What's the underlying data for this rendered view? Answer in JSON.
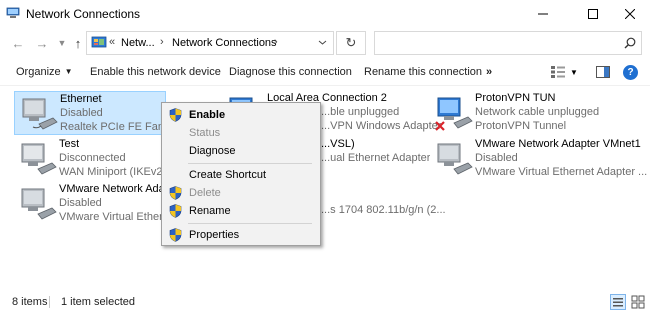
{
  "window": {
    "title": "Network Connections"
  },
  "address": {
    "crumbs": [
      "Netw...",
      "Network Connections"
    ],
    "overflow": "«",
    "search_placeholder": ""
  },
  "toolbar": {
    "organize": "Organize",
    "enable_device": "Enable this network device",
    "diagnose": "Diagnose this connection",
    "rename": "Rename this connection",
    "more": "»"
  },
  "connections": [
    {
      "name": "Ethernet",
      "status": "Disabled",
      "device": "Realtek PCIe FE Family C",
      "selected": true,
      "icon": "ethernet-adapter-icon"
    },
    {
      "name": "Local Area Connection 2",
      "status": "...ble unplugged",
      "device": "...VPN Windows Adapter",
      "selected": false,
      "icon": "ethernet-adapter-icon"
    },
    {
      "name": "ProtonVPN TUN",
      "status": "Network cable unplugged",
      "device": "ProtonVPN Tunnel",
      "selected": false,
      "icon": "disconnected-adapter-icon"
    },
    {
      "name": "Test",
      "status": "Disconnected",
      "device": "WAN Miniport (IKEv2)",
      "selected": false,
      "icon": "wan-adapter-icon"
    },
    {
      "name": "...VSL)",
      "status": "",
      "device": "...ual Ethernet Adapter",
      "selected": false,
      "icon": "ethernet-adapter-icon"
    },
    {
      "name": "VMware Network Adapter VMnet1",
      "status": "Disabled",
      "device": "VMware Virtual Ethernet Adapter ...",
      "selected": false,
      "icon": "ethernet-adapter-icon"
    },
    {
      "name": "VMware Network Adapt",
      "status": "Disabled",
      "device": "VMware Virtual Ethernet",
      "selected": false,
      "icon": "ethernet-adapter-icon"
    },
    {
      "name": "",
      "status": "",
      "device": "...s 1704 802.11b/g/n (2...",
      "selected": false,
      "icon": "wifi-adapter-icon"
    }
  ],
  "context_menu": {
    "items": [
      {
        "label": "Enable",
        "bold": true,
        "disabled": false,
        "shield": true
      },
      {
        "label": "Status",
        "bold": false,
        "disabled": true,
        "shield": false
      },
      {
        "label": "Diagnose",
        "bold": false,
        "disabled": false,
        "shield": false
      },
      {
        "label": "Create Shortcut",
        "bold": false,
        "disabled": false,
        "shield": false
      },
      {
        "label": "Delete",
        "bold": false,
        "disabled": true,
        "shield": true
      },
      {
        "label": "Rename",
        "bold": false,
        "disabled": false,
        "shield": true
      },
      {
        "label": "Properties",
        "bold": false,
        "disabled": false,
        "shield": true
      }
    ]
  },
  "status": {
    "count": "8 items",
    "selection": "1 item selected"
  },
  "colors": {
    "selection_bg": "#cce8ff",
    "selection_border": "#99d1ff",
    "menu_bg": "#f2f2f2",
    "help": "#1f6fd1"
  }
}
